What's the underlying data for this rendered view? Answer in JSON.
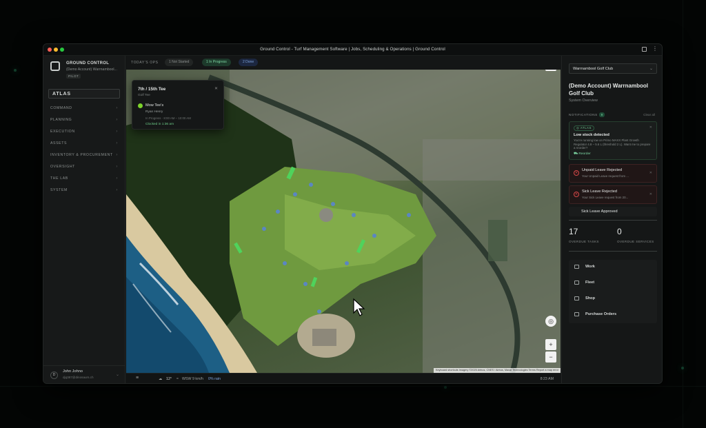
{
  "window": {
    "title": "Ground Control - Turf Management Software | Jobs, Scheduling & Operations | Ground Control"
  },
  "sidebar": {
    "brand": "GROUND CONTROL",
    "account": "(Demo Account) Warrnambool...",
    "badge": "PILOT",
    "atlas_label": "ATLAS",
    "nav": [
      "COMMAND",
      "PLANNING",
      "EXECUTION",
      "ASSETS",
      "INVENTORY & PROCUREMENT",
      "OVERSIGHT",
      "THE LAB",
      "SYSTEM"
    ],
    "user": {
      "initial": "D",
      "name": "John Johno",
      "email": "djq387@dinosaurs.ch"
    }
  },
  "ops": {
    "label": "TODAY'S OPS",
    "pills": [
      {
        "label": "1 Not Started",
        "color": "#8d9291",
        "bg": "#222524"
      },
      {
        "label": "1 In Progress",
        "color": "#7ed9a5",
        "bg": "#1d3a2b"
      },
      {
        "label": "2 Done",
        "color": "#7fa6e0",
        "bg": "#1c2740"
      }
    ]
  },
  "popup": {
    "title": "7th / 15th Tee",
    "subtitle": "Golf Tee",
    "task": "Mow Tee's",
    "person": "Ryan Henry",
    "time": "In Progress · 8:00 AM – 10:00 AM",
    "clocked": "Clocked in 1:36 am"
  },
  "map": {
    "attribution": "Keyboard shortcuts   Imagery ©2025 Airbus, CNES / Airbus, Maxar Technologies   Terms   Report a map error",
    "zoom_in": "+",
    "zoom_out": "−"
  },
  "status_bar": {
    "temp": "12°",
    "wind": "WSW 9 km/h",
    "rain": "0% rain",
    "time": "8:23 AM"
  },
  "panel": {
    "club_select": "Warrnambool Golf Club",
    "club_title": "(Demo Account) Warrnambool Golf Club",
    "club_subtitle": "System Overview",
    "notifications_label": "NOTIFICATIONS",
    "notifications_count": "9",
    "clear_all": "Clear all",
    "atlas_card": {
      "tag": "ATLAS",
      "title": "Low stock detected",
      "body": "You're running low on Primo MAXX Plant Growth Regulator 4.8 – 5.6 L (threshold 2 L). Want me to prepare a reorder?",
      "action": "Reorder"
    },
    "alerts": [
      {
        "title": "Unpaid Leave Rejected",
        "body": "Your Unpaid Leave request from ..."
      },
      {
        "title": "Sick Leave Rejected",
        "body": "Your Sick Leave request from 20..."
      },
      {
        "title": "Sick Leave Approved",
        "body": ""
      }
    ],
    "stats": [
      {
        "value": "17",
        "label": "OVERDUE TASKS"
      },
      {
        "value": "0",
        "label": "OVERDUE SERVICES"
      }
    ],
    "links": [
      "Work",
      "Fleet",
      "Shop",
      "Purchase Orders"
    ]
  }
}
